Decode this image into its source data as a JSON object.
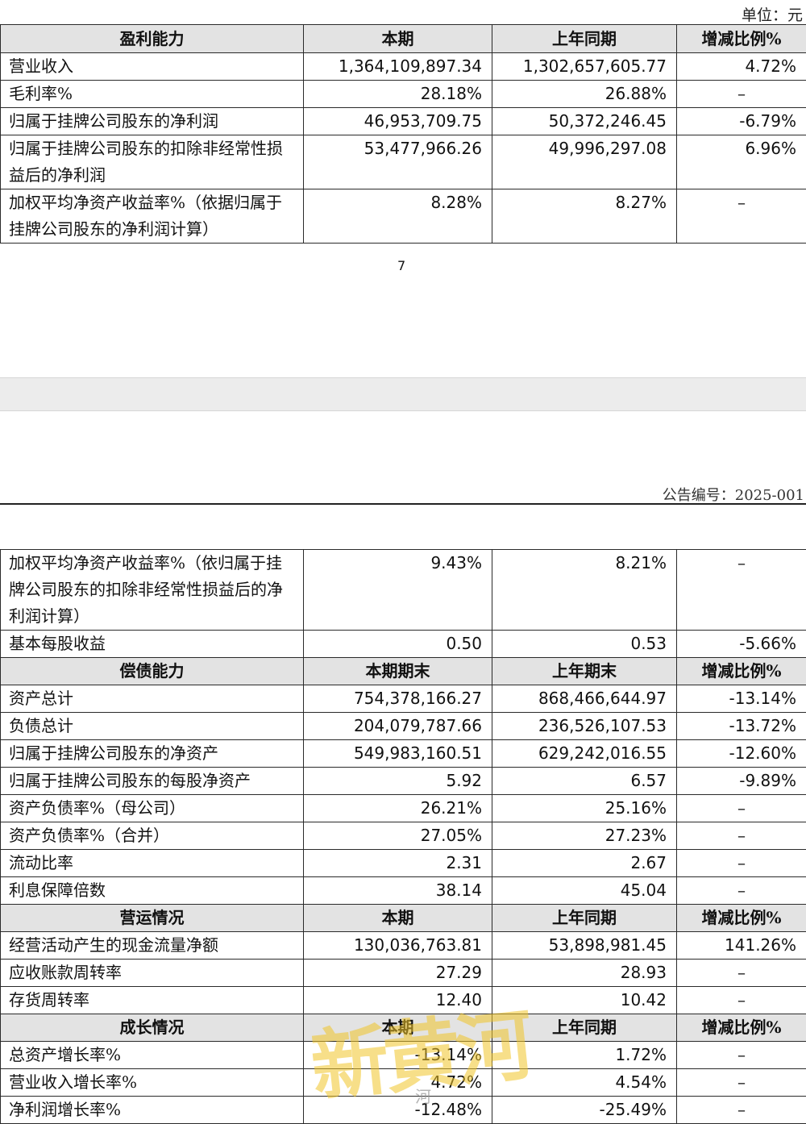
{
  "unit_label": "单位：元",
  "page_number": "7",
  "announcement_no": "公告编号：2025-001",
  "watermark": {
    "text": "新黄河",
    "small": "河"
  },
  "table1": {
    "header": [
      "盈利能力",
      "本期",
      "上年同期",
      "增减比例%"
    ],
    "rows": [
      [
        "营业收入",
        "1,364,109,897.34",
        "1,302,657,605.77",
        "4.72%"
      ],
      [
        "毛利率%",
        "28.18%",
        "26.88%",
        "–"
      ],
      [
        "归属于挂牌公司股东的净利润",
        "46,953,709.75",
        "50,372,246.45",
        "-6.79%"
      ],
      [
        "归属于挂牌公司股东的扣除非经常性损益后的净利润",
        "53,477,966.26",
        "49,996,297.08",
        "6.96%"
      ],
      [
        "加权平均净资产收益率%（依据归属于挂牌公司股东的净利润计算）",
        "8.28%",
        "8.27%",
        "–"
      ]
    ]
  },
  "table2": {
    "rows_top": [
      [
        "加权平均净资产收益率%（依归属于挂牌公司股东的扣除非经常性损益后的净利润计算）",
        "9.43%",
        "8.21%",
        "–"
      ],
      [
        "基本每股收益",
        "0.50",
        "0.53",
        "-5.66%"
      ]
    ],
    "solvency": {
      "header": [
        "偿债能力",
        "本期期末",
        "上年期末",
        "增减比例%"
      ],
      "rows": [
        [
          "资产总计",
          "754,378,166.27",
          "868,466,644.97",
          "-13.14%"
        ],
        [
          "负债总计",
          "204,079,787.66",
          "236,526,107.53",
          "-13.72%"
        ],
        [
          "归属于挂牌公司股东的净资产",
          "549,983,160.51",
          "629,242,016.55",
          "-12.60%"
        ],
        [
          "归属于挂牌公司股东的每股净资产",
          "5.92",
          "6.57",
          "-9.89%"
        ],
        [
          "资产负债率%（母公司）",
          "26.21%",
          "25.16%",
          "–"
        ],
        [
          "资产负债率%（合并）",
          "27.05%",
          "27.23%",
          "–"
        ],
        [
          "流动比率",
          "2.31",
          "2.67",
          "–"
        ],
        [
          "利息保障倍数",
          "38.14",
          "45.04",
          "–"
        ]
      ]
    },
    "operations": {
      "header": [
        "营运情况",
        "本期",
        "上年同期",
        "增减比例%"
      ],
      "rows": [
        [
          "经营活动产生的现金流量净额",
          "130,036,763.81",
          "53,898,981.45",
          "141.26%"
        ],
        [
          "应收账款周转率",
          "27.29",
          "28.93",
          "–"
        ],
        [
          "存货周转率",
          "12.40",
          "10.42",
          "–"
        ]
      ]
    },
    "growth": {
      "header": [
        "成长情况",
        "本期",
        "上年同期",
        "增减比例%"
      ],
      "rows": [
        [
          "总资产增长率%",
          "-13.14%",
          "1.72%",
          "–"
        ],
        [
          "营业收入增长率%",
          "4.72%",
          "4.54%",
          "–"
        ],
        [
          "净利润增长率%",
          "-12.48%",
          "-25.49%",
          "–"
        ]
      ]
    }
  }
}
